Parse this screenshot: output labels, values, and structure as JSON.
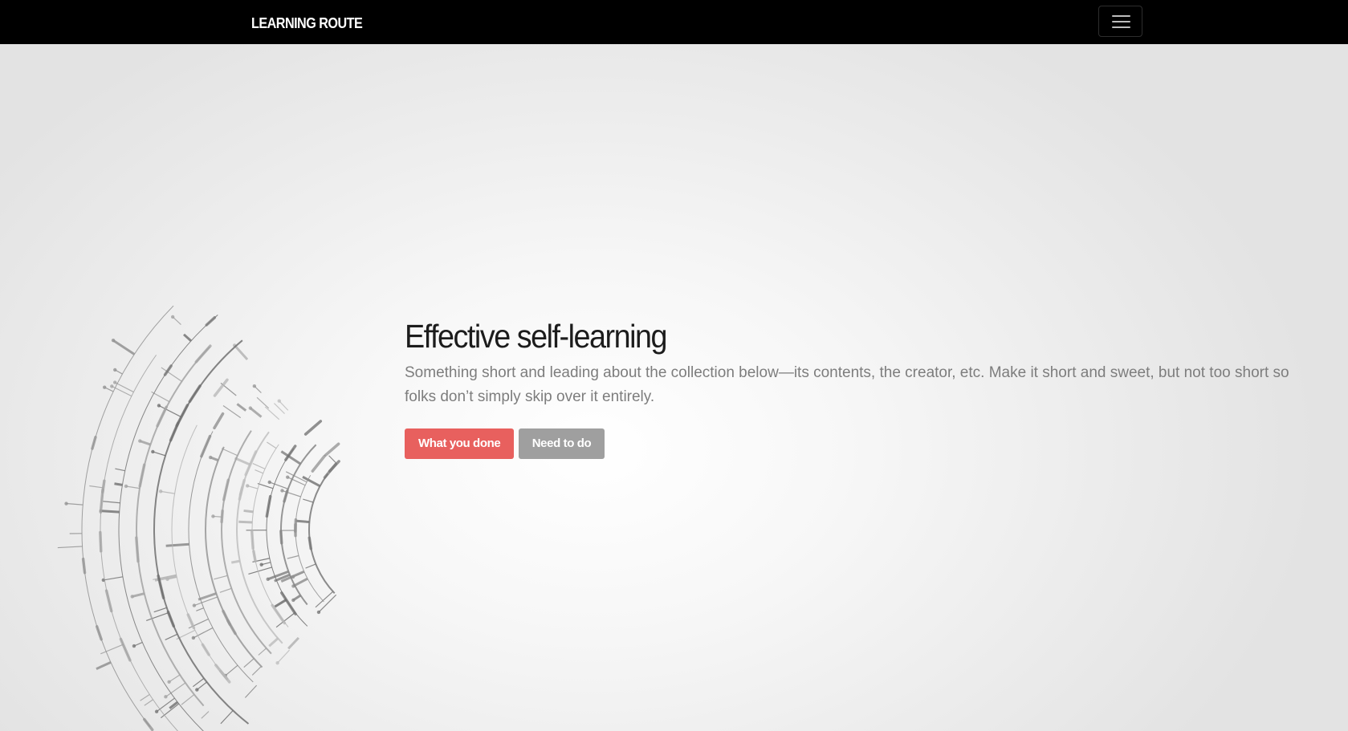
{
  "navbar": {
    "brand": "LEARNING ROUTE",
    "toggler_icon": "hamburger-menu-icon"
  },
  "hero": {
    "title": "Effective self-learning",
    "lead": "Something short and leading about the collection below—its contents, the creator, etc. Make it short and sweet, but not too short so folks don’t simply skip over it entirely.",
    "primary_button": "What you done",
    "secondary_button": "Need to do"
  },
  "colors": {
    "navbar": "#000000",
    "primary_button": "#e8605e",
    "secondary_button": "#9f9f9f",
    "title": "#1c1c1c",
    "lead": "#7d7d7d"
  },
  "decoration": {
    "icon": "circuit-arc-graphic"
  }
}
